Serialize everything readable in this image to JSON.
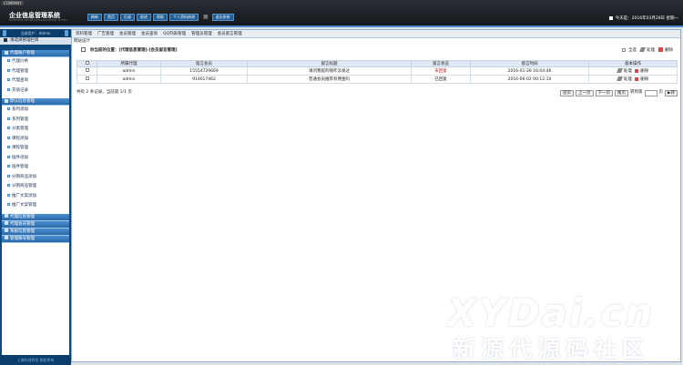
{
  "header": {
    "company_tag": "COMPANY",
    "system_name": "企业信息管理系统",
    "system_name_en": "ENTERPRISE INFORMATION MANAGEMENT SYSTEM",
    "nav": [
      "刷新",
      "首页",
      "后退",
      "前进",
      "帮助",
      "个人资料修改"
    ],
    "logout": "退出系统",
    "today": "今天是：2016年03月28日 星期一"
  },
  "sidebar": {
    "user": "当前用户：Admin",
    "select_column": "请选择管理栏目",
    "groups": [
      {
        "label": "代理账户管理",
        "items": [
          "代理价格",
          "代理管理",
          "代理查询",
          "充值记录"
        ]
      },
      {
        "label": "默认信息管理",
        "items": [
          "系列添加",
          "系列管理",
          "分类管理",
          "课程添加",
          "课程管理",
          "插件添加",
          "插件管理",
          "分销商品添加",
          "分销商品管理",
          "推广文案添加",
          "推广文案管理"
        ]
      },
      {
        "label": "代理信息管理",
        "items": []
      },
      {
        "label": "代理会员管理",
        "items": []
      },
      {
        "label": "系统信息管理",
        "items": []
      },
      {
        "label": "管理账号管理",
        "items": []
      }
    ],
    "footer": "上海科创科技 版权所有"
  },
  "main": {
    "tabs": [
      "资料管理",
      "广告管理",
      "会员管理",
      "会员查询",
      "QQ列表管理",
      "管理员管理",
      "会员留言管理"
    ],
    "subtitle": "网站设计",
    "location_label": "你当前的位置：",
    "location_path": "[代理信息管理]-[会员留言管理]",
    "select_all": "全选",
    "process": "处理",
    "delete": "删除",
    "table": {
      "headers": [
        "",
        "所属代理",
        "留言会员",
        "留言标题",
        "留言状态",
        "留言时间",
        "基本操作"
      ],
      "rows": [
        {
          "agent": "admin",
          "member": "15554729669",
          "title": "请问我提的钱咋没发过",
          "status": "未回复",
          "time": "2016-01-28 16:04:46"
        },
        {
          "agent": "admin",
          "member": "914617462",
          "title": "普通会员推荐有佣金吗",
          "status": "已回复",
          "time": "2016-06-02 00:12:10"
        }
      ],
      "op_process": "处理",
      "op_delete": "删除"
    },
    "pager": {
      "summary": "共有 2 条记录，当前第 1/1 页",
      "first": "首页",
      "prev": "上一页",
      "next": "下一页",
      "last": "尾页",
      "goto": "转到第",
      "page_unit": "页",
      "go": "转"
    }
  },
  "watermark": {
    "line1": "XYDai.cn",
    "line2": "新源代源码社区"
  }
}
